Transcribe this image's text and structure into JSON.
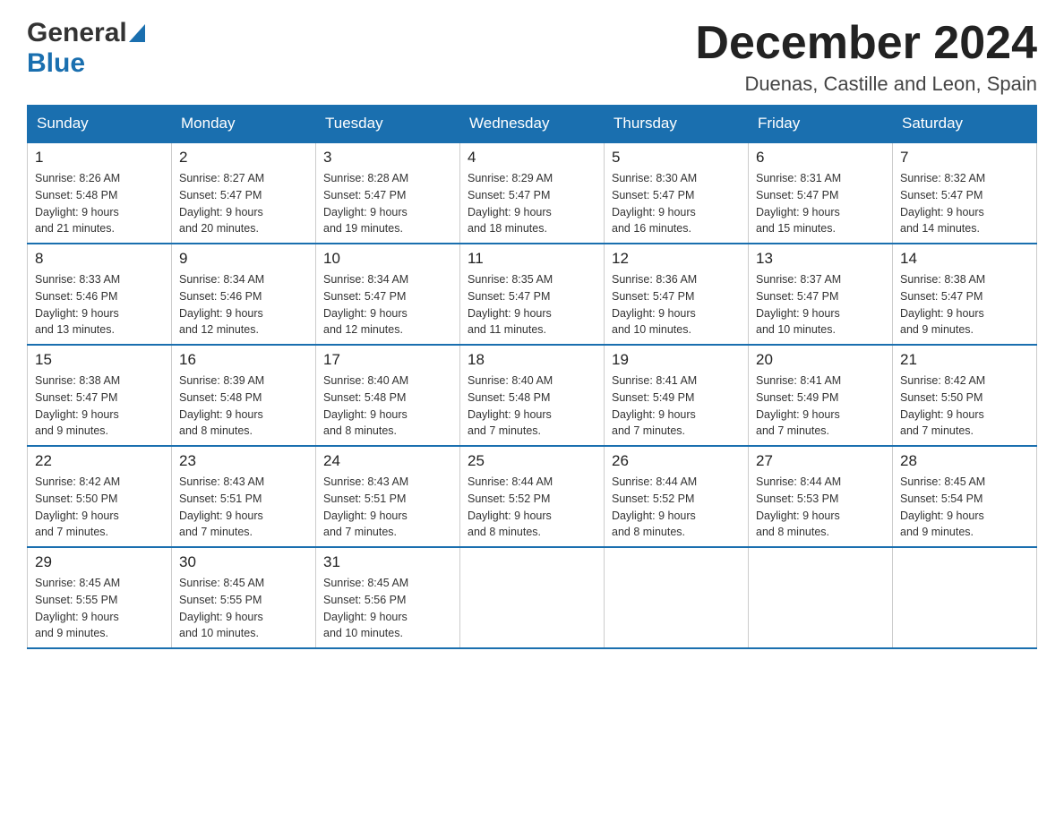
{
  "header": {
    "logo_general": "General",
    "logo_blue": "Blue",
    "month_title": "December 2024",
    "location": "Duenas, Castille and Leon, Spain"
  },
  "weekdays": [
    "Sunday",
    "Monday",
    "Tuesday",
    "Wednesday",
    "Thursday",
    "Friday",
    "Saturday"
  ],
  "weeks": [
    [
      {
        "day": "1",
        "sunrise": "8:26 AM",
        "sunset": "5:48 PM",
        "daylight": "9 hours and 21 minutes."
      },
      {
        "day": "2",
        "sunrise": "8:27 AM",
        "sunset": "5:47 PM",
        "daylight": "9 hours and 20 minutes."
      },
      {
        "day": "3",
        "sunrise": "8:28 AM",
        "sunset": "5:47 PM",
        "daylight": "9 hours and 19 minutes."
      },
      {
        "day": "4",
        "sunrise": "8:29 AM",
        "sunset": "5:47 PM",
        "daylight": "9 hours and 18 minutes."
      },
      {
        "day": "5",
        "sunrise": "8:30 AM",
        "sunset": "5:47 PM",
        "daylight": "9 hours and 16 minutes."
      },
      {
        "day": "6",
        "sunrise": "8:31 AM",
        "sunset": "5:47 PM",
        "daylight": "9 hours and 15 minutes."
      },
      {
        "day": "7",
        "sunrise": "8:32 AM",
        "sunset": "5:47 PM",
        "daylight": "9 hours and 14 minutes."
      }
    ],
    [
      {
        "day": "8",
        "sunrise": "8:33 AM",
        "sunset": "5:46 PM",
        "daylight": "9 hours and 13 minutes."
      },
      {
        "day": "9",
        "sunrise": "8:34 AM",
        "sunset": "5:46 PM",
        "daylight": "9 hours and 12 minutes."
      },
      {
        "day": "10",
        "sunrise": "8:34 AM",
        "sunset": "5:47 PM",
        "daylight": "9 hours and 12 minutes."
      },
      {
        "day": "11",
        "sunrise": "8:35 AM",
        "sunset": "5:47 PM",
        "daylight": "9 hours and 11 minutes."
      },
      {
        "day": "12",
        "sunrise": "8:36 AM",
        "sunset": "5:47 PM",
        "daylight": "9 hours and 10 minutes."
      },
      {
        "day": "13",
        "sunrise": "8:37 AM",
        "sunset": "5:47 PM",
        "daylight": "9 hours and 10 minutes."
      },
      {
        "day": "14",
        "sunrise": "8:38 AM",
        "sunset": "5:47 PM",
        "daylight": "9 hours and 9 minutes."
      }
    ],
    [
      {
        "day": "15",
        "sunrise": "8:38 AM",
        "sunset": "5:47 PM",
        "daylight": "9 hours and 9 minutes."
      },
      {
        "day": "16",
        "sunrise": "8:39 AM",
        "sunset": "5:48 PM",
        "daylight": "9 hours and 8 minutes."
      },
      {
        "day": "17",
        "sunrise": "8:40 AM",
        "sunset": "5:48 PM",
        "daylight": "9 hours and 8 minutes."
      },
      {
        "day": "18",
        "sunrise": "8:40 AM",
        "sunset": "5:48 PM",
        "daylight": "9 hours and 7 minutes."
      },
      {
        "day": "19",
        "sunrise": "8:41 AM",
        "sunset": "5:49 PM",
        "daylight": "9 hours and 7 minutes."
      },
      {
        "day": "20",
        "sunrise": "8:41 AM",
        "sunset": "5:49 PM",
        "daylight": "9 hours and 7 minutes."
      },
      {
        "day": "21",
        "sunrise": "8:42 AM",
        "sunset": "5:50 PM",
        "daylight": "9 hours and 7 minutes."
      }
    ],
    [
      {
        "day": "22",
        "sunrise": "8:42 AM",
        "sunset": "5:50 PM",
        "daylight": "9 hours and 7 minutes."
      },
      {
        "day": "23",
        "sunrise": "8:43 AM",
        "sunset": "5:51 PM",
        "daylight": "9 hours and 7 minutes."
      },
      {
        "day": "24",
        "sunrise": "8:43 AM",
        "sunset": "5:51 PM",
        "daylight": "9 hours and 7 minutes."
      },
      {
        "day": "25",
        "sunrise": "8:44 AM",
        "sunset": "5:52 PM",
        "daylight": "9 hours and 8 minutes."
      },
      {
        "day": "26",
        "sunrise": "8:44 AM",
        "sunset": "5:52 PM",
        "daylight": "9 hours and 8 minutes."
      },
      {
        "day": "27",
        "sunrise": "8:44 AM",
        "sunset": "5:53 PM",
        "daylight": "9 hours and 8 minutes."
      },
      {
        "day": "28",
        "sunrise": "8:45 AM",
        "sunset": "5:54 PM",
        "daylight": "9 hours and 9 minutes."
      }
    ],
    [
      {
        "day": "29",
        "sunrise": "8:45 AM",
        "sunset": "5:55 PM",
        "daylight": "9 hours and 9 minutes."
      },
      {
        "day": "30",
        "sunrise": "8:45 AM",
        "sunset": "5:55 PM",
        "daylight": "9 hours and 10 minutes."
      },
      {
        "day": "31",
        "sunrise": "8:45 AM",
        "sunset": "5:56 PM",
        "daylight": "9 hours and 10 minutes."
      },
      null,
      null,
      null,
      null
    ]
  ],
  "labels": {
    "sunrise": "Sunrise:",
    "sunset": "Sunset:",
    "daylight": "Daylight:"
  }
}
